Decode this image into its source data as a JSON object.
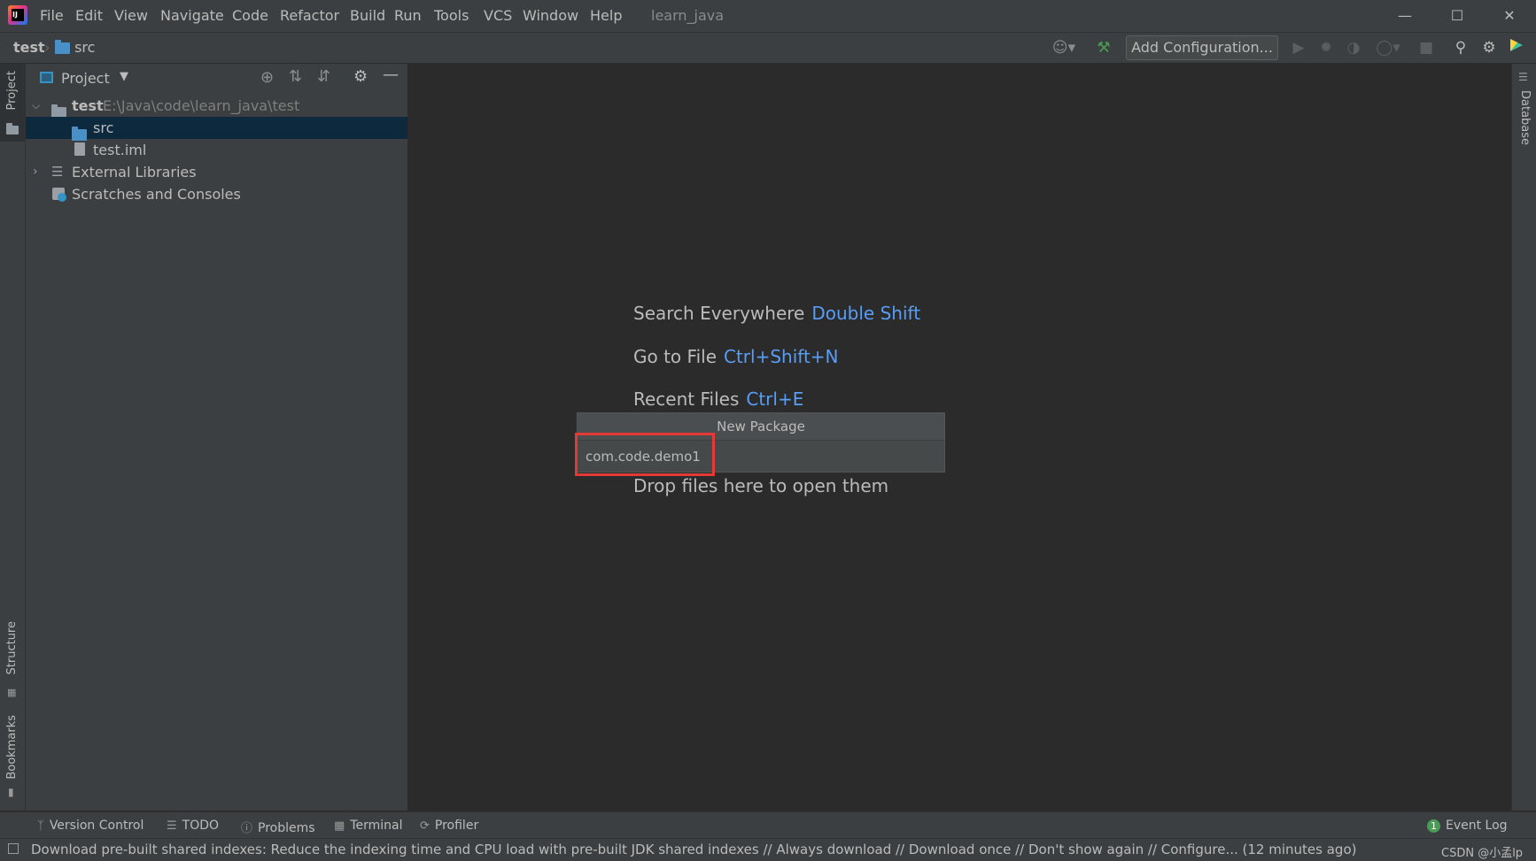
{
  "menu": {
    "items": [
      "File",
      "Edit",
      "View",
      "Navigate",
      "Code",
      "Refactor",
      "Build",
      "Run",
      "Tools",
      "VCS",
      "Window",
      "Help"
    ],
    "window_title": "learn_java"
  },
  "breadcrumb": {
    "project": "test",
    "folder": "src"
  },
  "toolbar": {
    "add_configuration": "Add Configuration..."
  },
  "left_stripe": {
    "project": "Project",
    "structure": "Structure",
    "bookmarks": "Bookmarks"
  },
  "right_stripe": {
    "database": "Database"
  },
  "project_panel": {
    "title": "Project",
    "tree": [
      {
        "label": "test",
        "path": "E:\\Java\\code\\learn_java\\test"
      },
      {
        "label": "src"
      },
      {
        "label": "test.iml"
      },
      {
        "label": "External Libraries"
      },
      {
        "label": "Scratches and Consoles"
      }
    ]
  },
  "editor_hints": [
    {
      "action": "Search Everywhere",
      "shortcut": "Double Shift"
    },
    {
      "action": "Go to File",
      "shortcut": "Ctrl+Shift+N"
    },
    {
      "action": "Recent Files",
      "shortcut": "Ctrl+E"
    },
    {
      "action": "Drop files here to open them"
    }
  ],
  "new_package_popup": {
    "title": "New Package",
    "value": "com.code.demo1"
  },
  "bottom_tools": {
    "version_control": "Version Control",
    "todo": "TODO",
    "problems": "Problems",
    "terminal": "Terminal",
    "profiler": "Profiler",
    "event_log": "Event Log",
    "event_count": "1"
  },
  "status": {
    "message": "Download pre-built shared indexes: Reduce the indexing time and CPU load with pre-built JDK shared indexes // Always download // Download once // Don't show again // Configure... (12 minutes ago)",
    "watermark": "CSDN @小孟lp"
  }
}
